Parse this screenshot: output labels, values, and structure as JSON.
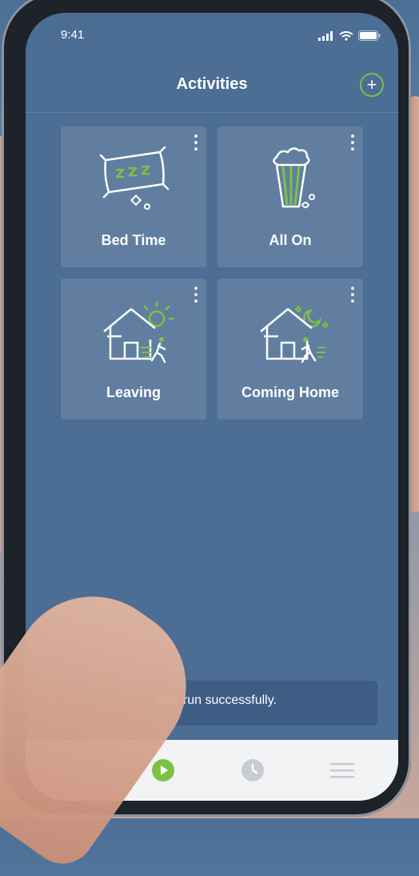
{
  "status_bar": {
    "time": "9:41"
  },
  "header": {
    "title": "Activities",
    "add_icon": "plus-circle-icon"
  },
  "activities": [
    {
      "label": "Bed Time",
      "icon": "pillow-icon"
    },
    {
      "label": "All On",
      "icon": "popcorn-icon"
    },
    {
      "label": "Leaving",
      "icon": "house-leaving-icon"
    },
    {
      "label": "Coming Home",
      "icon": "house-coming-home-icon"
    }
  ],
  "toast": {
    "message": "was run successfully."
  },
  "tab_bar": {
    "items": [
      {
        "name": "home",
        "icon": "home-icon"
      },
      {
        "name": "activities",
        "icon": "play-icon"
      },
      {
        "name": "history",
        "icon": "clock-icon"
      },
      {
        "name": "menu",
        "icon": "hamburger-icon"
      }
    ]
  },
  "colors": {
    "accent": "#7cc242",
    "screen_bg": "#4c6d94",
    "card_bg": "#5b7ba0",
    "tab_bar_bg": "#f2f3f5"
  }
}
